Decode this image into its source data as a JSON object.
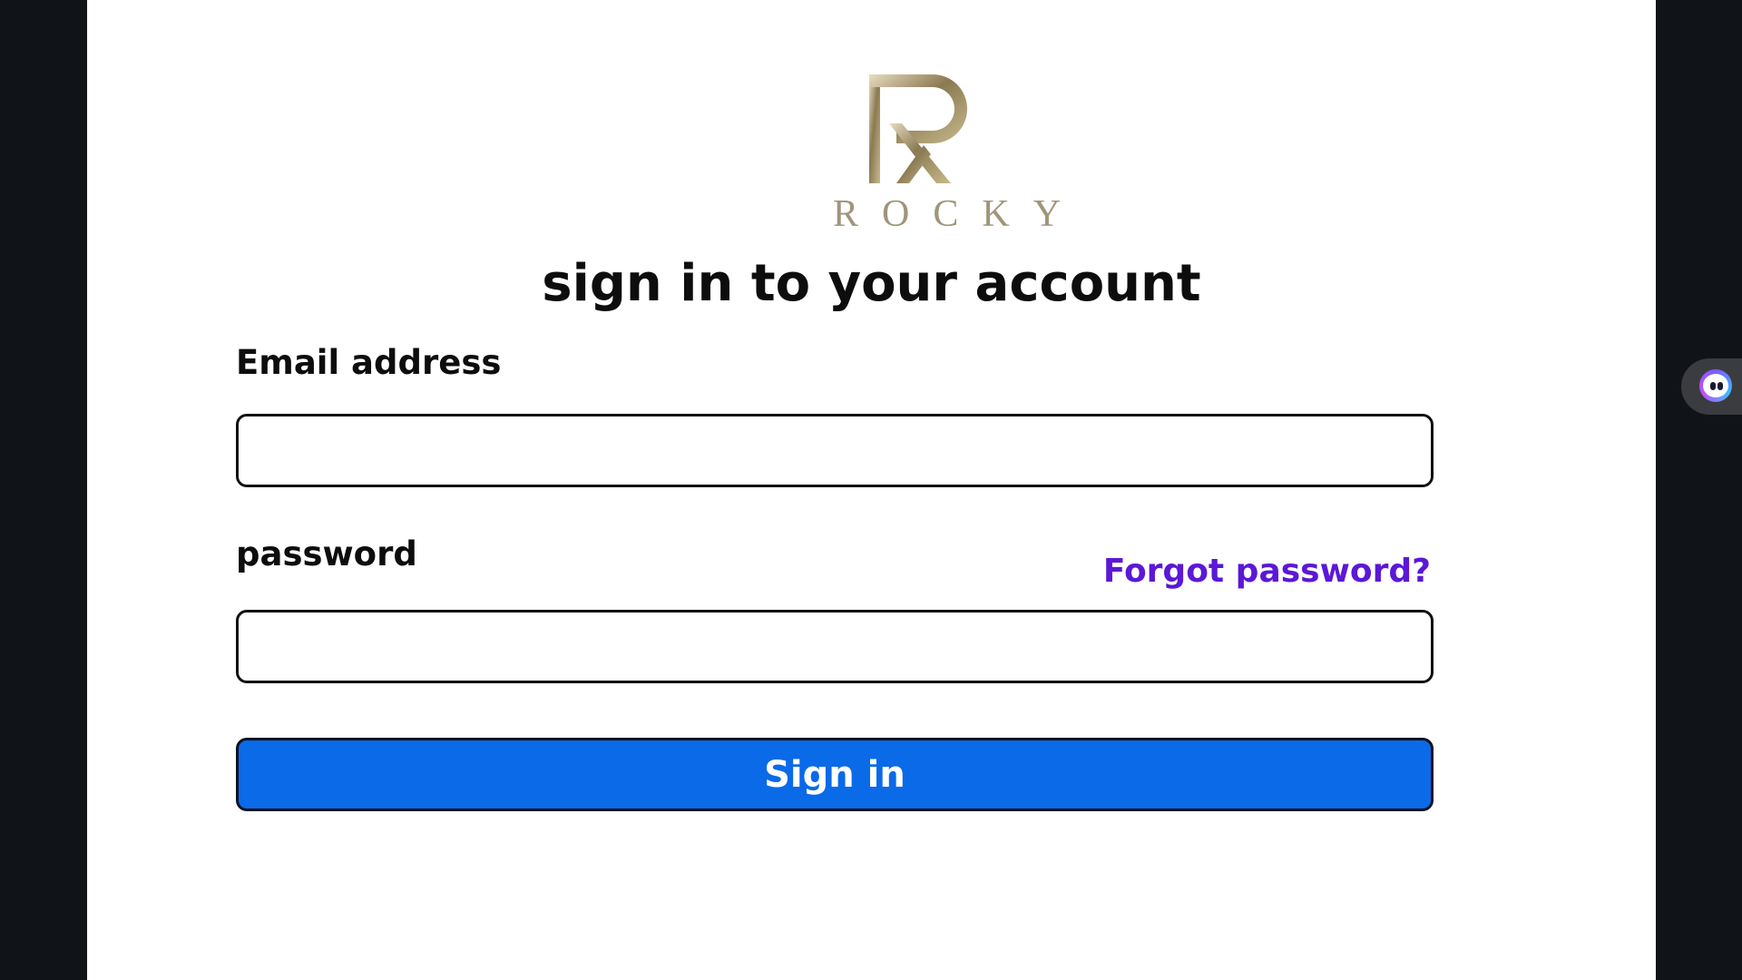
{
  "brand": {
    "wordmark": "ROCKY",
    "logo_colors": [
      "#c9b98c",
      "#8a7a52",
      "#e8dcc0"
    ]
  },
  "form": {
    "heading": "sign in to your account",
    "email_label": "Email address",
    "email_value": "",
    "password_label": "password",
    "password_value": "",
    "forgot_link": "Forgot password?",
    "submit_label": "Sign in"
  },
  "colors": {
    "page_background": "#101418",
    "panel_background": "#ffffff",
    "primary_button": "#0a6ae8",
    "link": "#5b18d6"
  },
  "extension_widget": {
    "icon": "assistant-face-icon"
  }
}
